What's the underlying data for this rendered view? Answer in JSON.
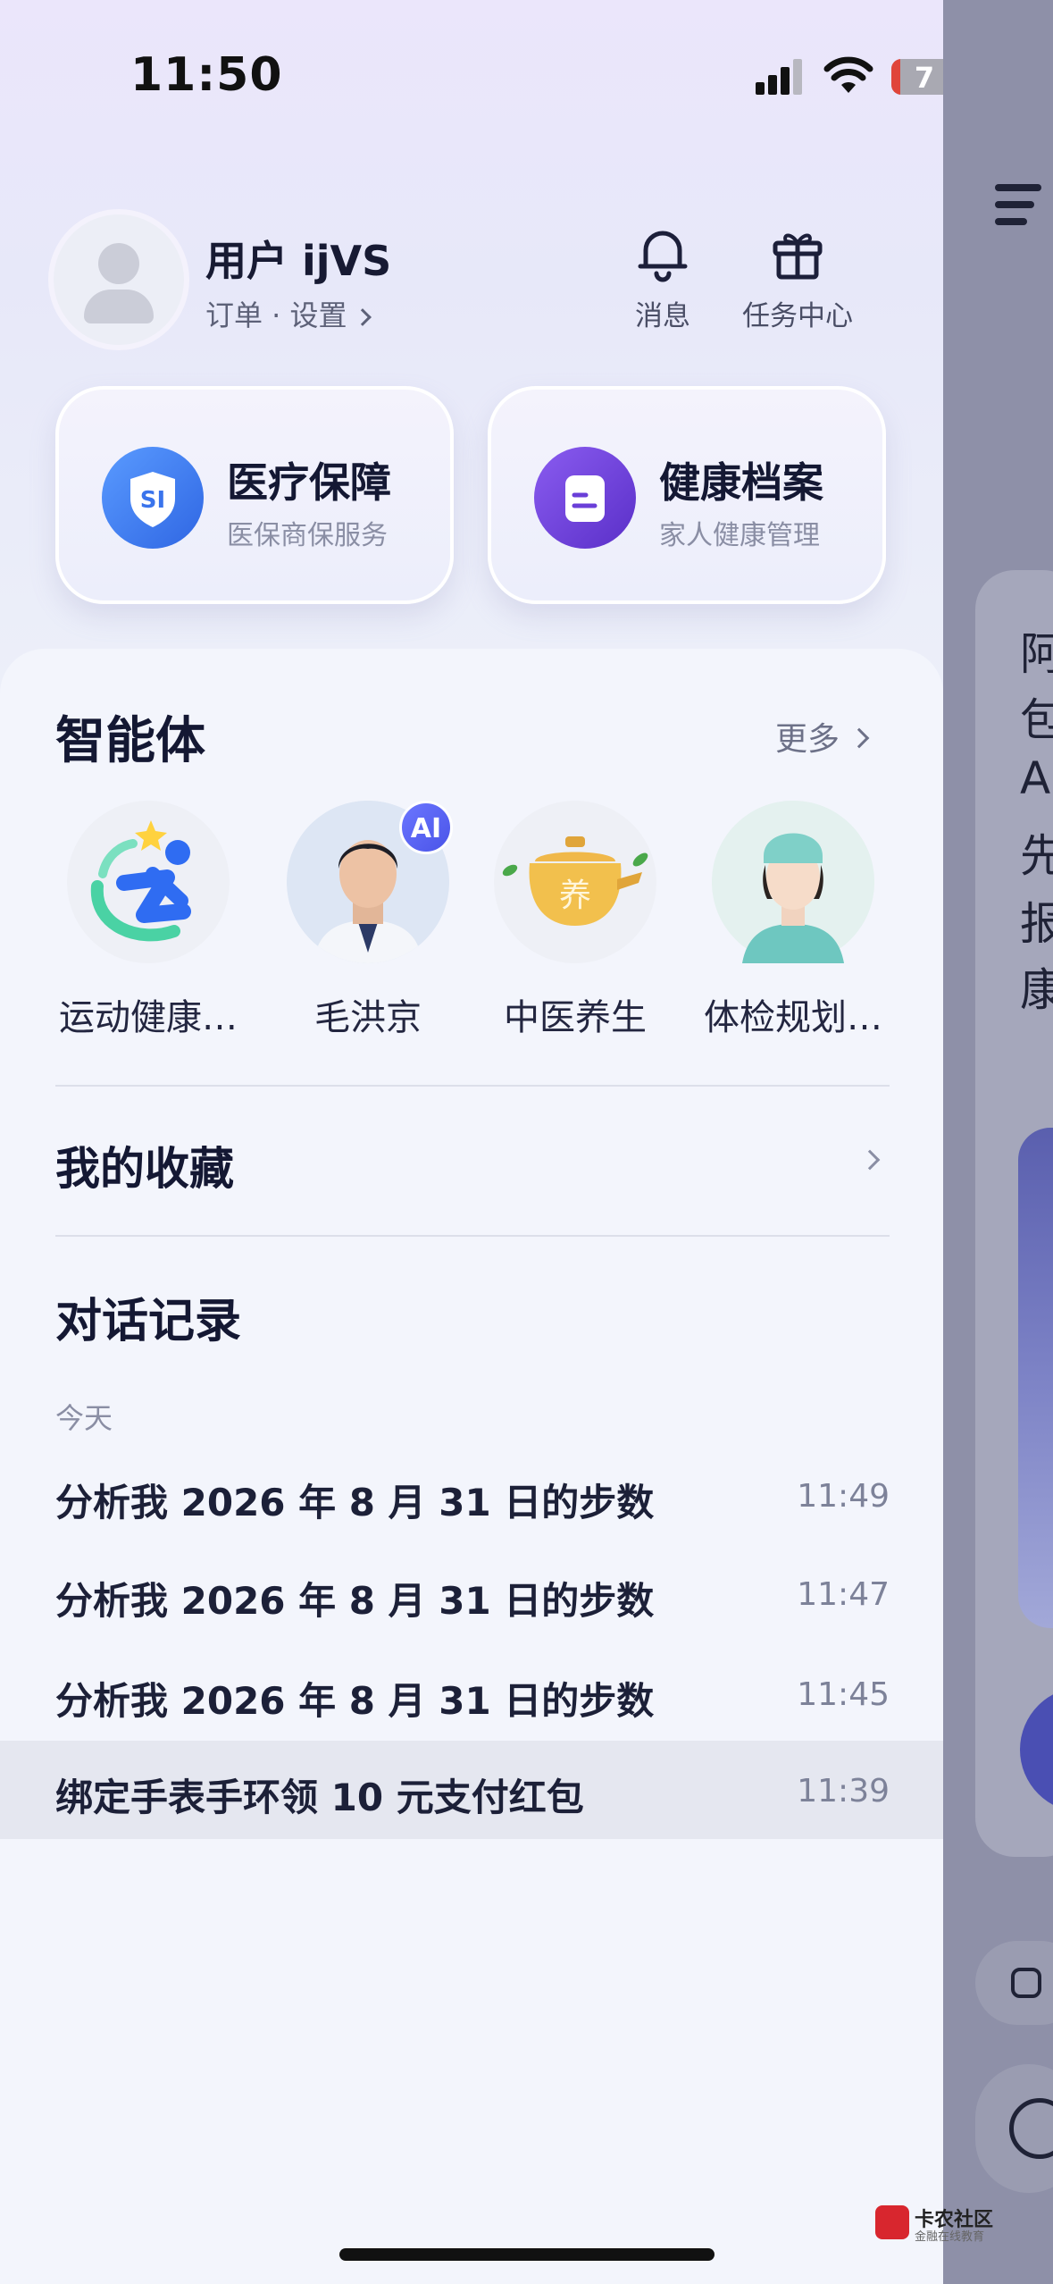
{
  "status_bar": {
    "time": "11:50",
    "battery": "7"
  },
  "profile": {
    "username": "用户 ijVS",
    "subtitle": "订单 · 设置"
  },
  "top_actions": [
    {
      "label": "消息",
      "icon": "bell-icon"
    },
    {
      "label": "任务中心",
      "icon": "gift-icon"
    }
  ],
  "service_cards": [
    {
      "title": "医疗保障",
      "subtitle": "医保商保服务",
      "icon": "shield-si-icon",
      "icon_text": "SI",
      "color": "#3f7df0"
    },
    {
      "title": "健康档案",
      "subtitle": "家人健康管理",
      "icon": "document-icon",
      "color": "#6a3fd8"
    }
  ],
  "agents": {
    "title": "智能体",
    "more": "更多",
    "items": [
      {
        "name": "运动健康…",
        "icon": "sport-logo-icon"
      },
      {
        "name": "毛洪京",
        "icon": "doctor-avatar",
        "badge": "AI"
      },
      {
        "name": "中医养生",
        "icon": "herbal-pot-icon",
        "icon_text": "养"
      },
      {
        "name": "体检规划…",
        "icon": "nurse-avatar"
      }
    ]
  },
  "favorites": {
    "label": "我的收藏"
  },
  "chat_history": {
    "title": "对话记录",
    "group_label": "今天",
    "items": [
      {
        "text": "分析我 2026 年 8 月 31 日的步数",
        "time": "11:49"
      },
      {
        "text": "分析我 2026 年 8 月 31 日的步数",
        "time": "11:47"
      },
      {
        "text": "分析我 2026 年 8 月 31 日的步数",
        "time": "11:45"
      },
      {
        "text": "绑定手表手环领 10 元支付红包",
        "time": "11:39"
      }
    ]
  },
  "right_page": {
    "chars": [
      "阿",
      "包",
      "A",
      "先",
      "报",
      "康"
    ]
  },
  "watermark": {
    "name": "卡农社区",
    "tagline": "金融在线教育"
  }
}
